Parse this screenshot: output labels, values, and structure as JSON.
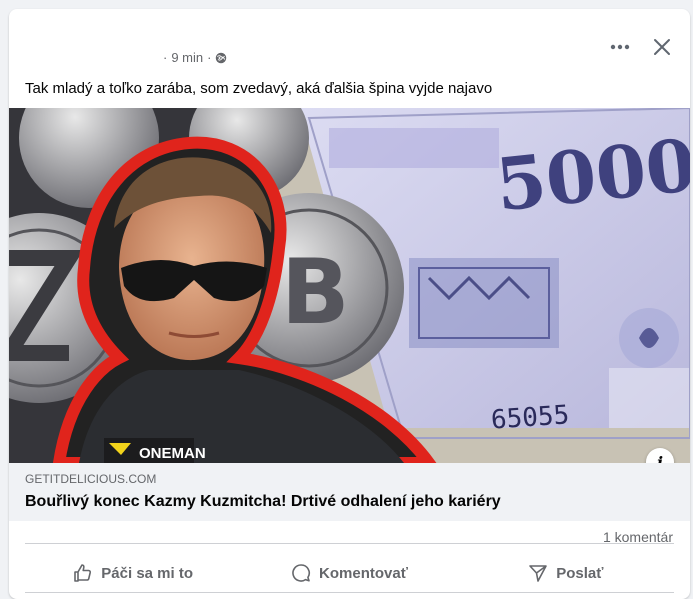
{
  "post": {
    "time": "9 min",
    "separator": "·",
    "audience_icon": "globe-icon",
    "text": "Tak mladý a toľko zarába, som zvedavý, aká ďalšia špina vyjde najavo"
  },
  "header_actions": {
    "more_icon": "more-dots-icon",
    "close_icon": "close-icon"
  },
  "image": {
    "banknote_value": "5000",
    "banknote_serial": "65055",
    "vest_logo_text": "ONEMAN"
  },
  "link_preview": {
    "domain": "GETITDELICIOUS.COM",
    "title": "Bouřlivý konec Kazmy Kuzmitcha! Drtivé odhalení jeho kariéry",
    "info_glyph": "i"
  },
  "stats": {
    "comments": "1 komentár"
  },
  "actions": {
    "like": "Páči sa mi to",
    "comment": "Komentovať",
    "share": "Poslať"
  },
  "colors": {
    "text_primary": "#050505",
    "text_secondary": "#65676b",
    "card_bg": "#ffffff",
    "page_bg": "#f0f2f5",
    "outline_red": "#e0241c"
  }
}
